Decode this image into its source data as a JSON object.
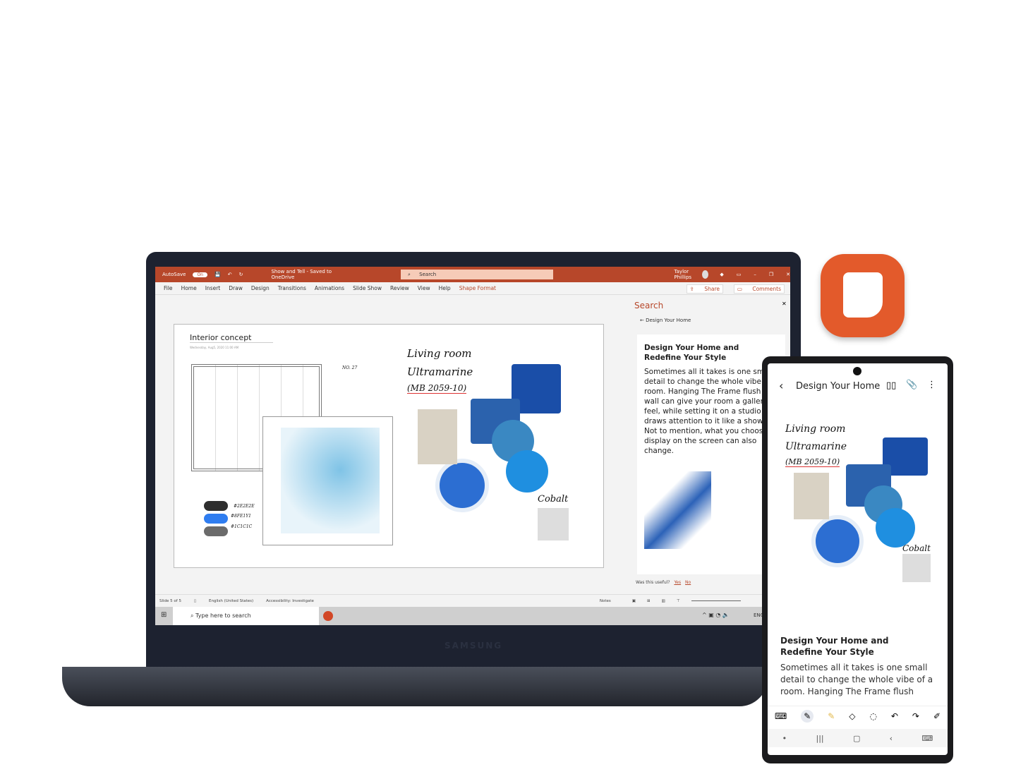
{
  "ppt": {
    "autosave": "AutoSave",
    "autosave_state": "On",
    "doc_title": "Show and Tell - Saved to OneDrive",
    "search": "Search",
    "user": "Taylor Phillips",
    "menu": [
      "File",
      "Home",
      "Insert",
      "Draw",
      "Design",
      "Transitions",
      "Animations",
      "Slide Show",
      "Review",
      "View",
      "Help",
      "Shape Format"
    ],
    "share": "Share",
    "comments": "Comments",
    "slide": {
      "title": "Interior concept",
      "date": "Wednesday, Aug5, 2020     11:00 AM",
      "no": "NO. 27",
      "colors": [
        "#2E2E2E",
        "#8FE1Y1",
        "#1C1C1C"
      ],
      "hand": [
        "Living room",
        "Ultramarine",
        "(MB 2059-10)",
        "Cobalt"
      ]
    },
    "pane": {
      "title": "Search",
      "back": "Design Your Home",
      "heading": "Design Your Home and Redefine Your Style",
      "body": "Sometimes all it takes is one small detail to change the whole vibe of a room. Hanging The Frame flush to the wall can give your room a gallery-like feel, while setting it on a studio stand draws attention to it like a showcase. Not to mention, what you choose to display on the screen can also change.",
      "useful": "Was this useful?",
      "yes": "Yes",
      "no": "No"
    },
    "status": {
      "slide": "Slide 5 of 5",
      "lang": "English (United States)",
      "access": "Accessibility: Investigate",
      "notes": "Notes"
    },
    "taskbar": {
      "search": "Type here to search",
      "lang": "ENG"
    }
  },
  "laptop_brand": "SAMSUNG",
  "phone": {
    "title": "Design Your Home",
    "heading": "Design Your Home and Redefine Your Style",
    "body": "Sometimes all it takes is one small detail to change the whole vibe of a room. Hanging The Frame flush",
    "tools": [
      "keyboard-icon",
      "pen-icon",
      "highlighter-icon",
      "eraser-icon",
      "lasso-icon",
      "undo-icon",
      "redo-icon",
      "pen-settings-icon"
    ]
  },
  "colors": {
    "ppt_accent": "#b7472a",
    "notes_icon": "#e35a2b",
    "ultramarine": "#1e4fa6"
  }
}
